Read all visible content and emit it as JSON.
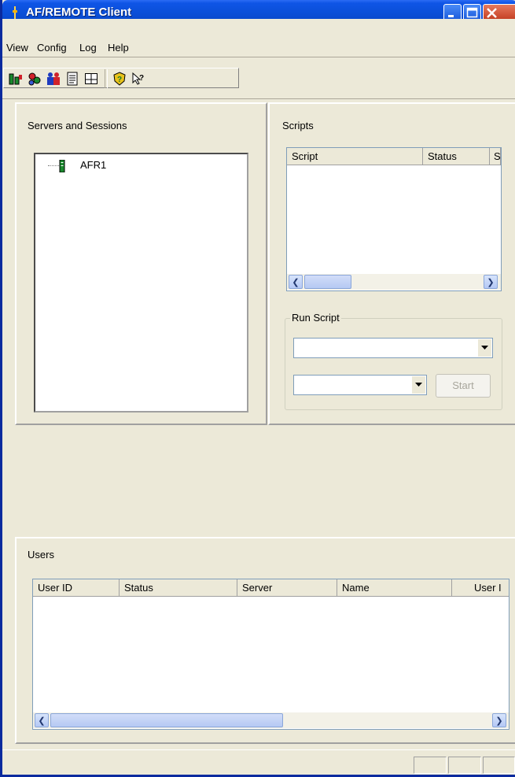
{
  "window": {
    "title": "AF/REMOTE Client",
    "colors": {
      "titlebar": "#0a4fd8",
      "face": "#ece9d8",
      "close": "#c0391d"
    }
  },
  "menu": {
    "items": [
      "View",
      "Config",
      "Log",
      "Help"
    ]
  },
  "toolbar": {
    "icons": [
      "servers-icon",
      "sessions-icon",
      "users-icon",
      "log-icon",
      "layout-icon",
      "help-icon",
      "whats-this-icon"
    ]
  },
  "servers_panel": {
    "heading": "Servers and Sessions",
    "tree": [
      {
        "label": "AFR1"
      }
    ]
  },
  "scripts_panel": {
    "heading": "Scripts",
    "columns": [
      "Script",
      "Status",
      "S"
    ],
    "run_script": {
      "legend": "Run Script",
      "script_select_value": "",
      "target_select_value": "",
      "start_label": "Start"
    }
  },
  "users_panel": {
    "heading": "Users",
    "columns": [
      "User ID",
      "Status",
      "Server",
      "Name",
      "User I"
    ]
  },
  "status_bar": {
    "cells": [
      "",
      "",
      ""
    ]
  }
}
